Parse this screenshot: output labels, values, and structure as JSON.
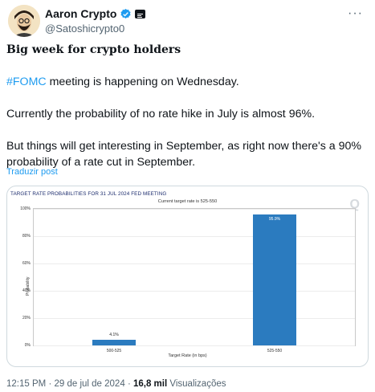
{
  "author": {
    "name": "Aaron Crypto",
    "handle": "@Satoshicrypto0"
  },
  "tweet": {
    "title": "Big week for crypto holders",
    "hashtag": "#FOMC",
    "line1_rest": " meeting is happening on Wednesday.",
    "line2": "Currently the probability of no rate hike in July is almost 96%.",
    "line3": "But things will get interesting in September, as right now there's a 90% probability of a rate cut in September.",
    "translate_label": "Traduzir post"
  },
  "chart_data": {
    "type": "bar",
    "title": "TARGET RATE PROBABILITIES FOR 31 JUL 2024 FED MEETING",
    "subtitle": "Current target rate is 525-550",
    "categories": [
      "500-525",
      "525-550"
    ],
    "values": [
      4.1,
      95.9
    ],
    "value_labels": [
      "4.1%",
      "95.9%"
    ],
    "xlabel": "Target Rate (in bps)",
    "ylabel": "Probability",
    "ylim": [
      0,
      100
    ],
    "yticks": [
      "0%",
      "20%",
      "40%",
      "60%",
      "80%",
      "100%"
    ],
    "bar_color": "#2b7bbf",
    "grid": true
  },
  "footer": {
    "time": "12:15 PM",
    "date": "29 de jul de 2024",
    "views_count": "16,8 mil",
    "views_label": "Visualizações",
    "separator": "·"
  },
  "icons": {
    "more": "more-options-icon",
    "verified": "verified-badge-icon",
    "badge": "affiliate-badge-icon"
  }
}
